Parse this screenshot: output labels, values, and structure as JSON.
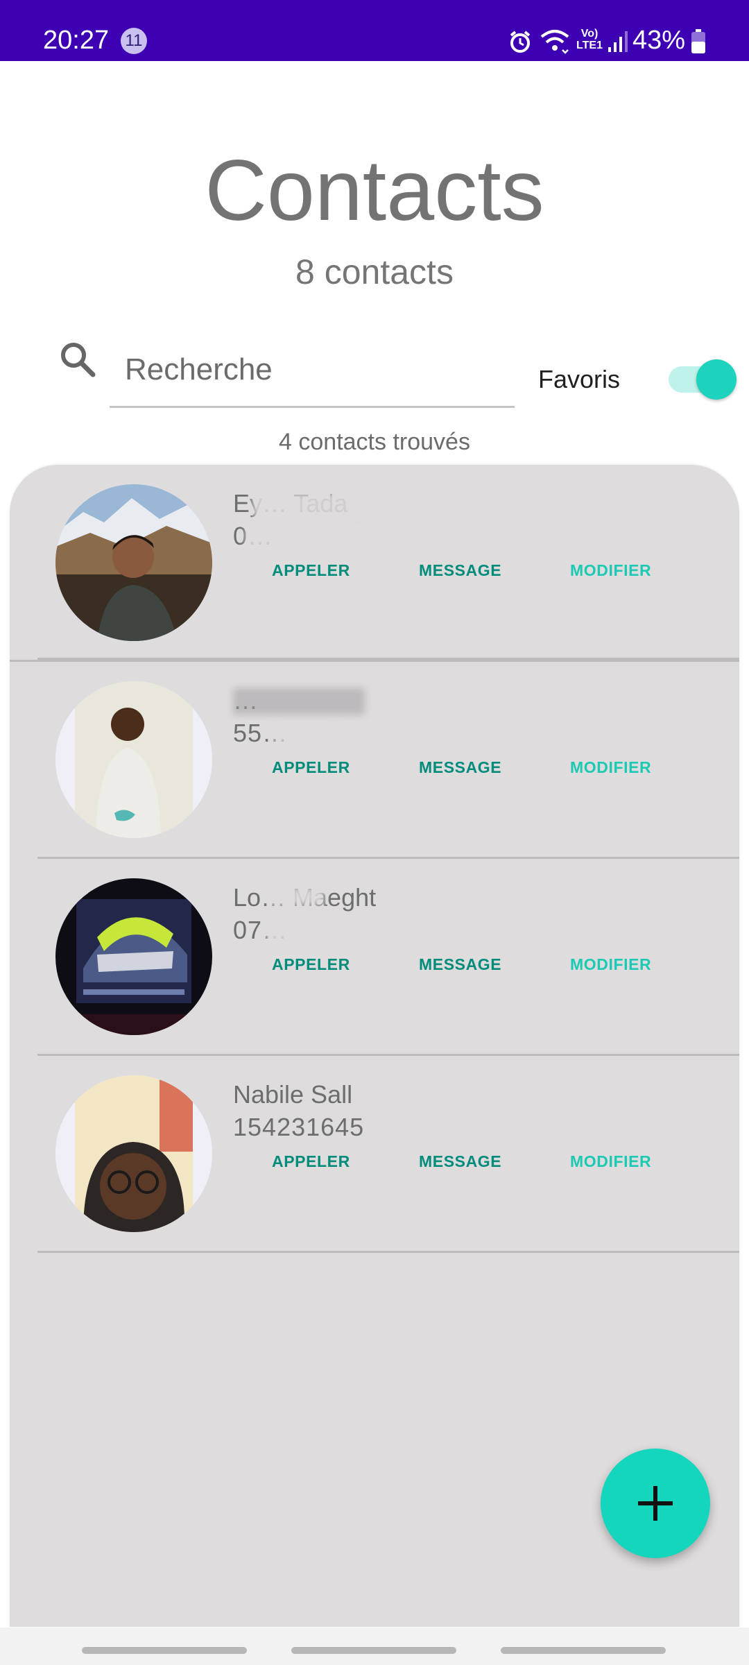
{
  "status_bar": {
    "time": "20:27",
    "notification_count": "11",
    "network_label": "Vo) LTE1",
    "battery": "43%",
    "icons": [
      "alarm-icon",
      "wifi-icon",
      "volte-icon",
      "signal-icon",
      "battery-icon"
    ]
  },
  "header": {
    "title": "Contacts",
    "count": "8 contacts"
  },
  "search": {
    "placeholder": "Recherche",
    "value": ""
  },
  "favorites": {
    "label": "Favoris",
    "enabled": true
  },
  "results": {
    "found_text": "4 contacts trouvés"
  },
  "contacts": [
    {
      "name": "Ey… Tada",
      "phone": "0…",
      "call_label": "APPELER",
      "message_label": "MESSAGE",
      "edit_label": "MODIFIER",
      "redacted": true
    },
    {
      "name": "…",
      "phone": "55…",
      "call_label": "APPELER",
      "message_label": "MESSAGE",
      "edit_label": "MODIFIER",
      "redacted": true
    },
    {
      "name": "Lo… Maeght",
      "phone": "07…",
      "call_label": "APPELER",
      "message_label": "MESSAGE",
      "edit_label": "MODIFIER",
      "redacted": true
    },
    {
      "name": "Nabile Sall",
      "phone": "154231645",
      "call_label": "APPELER",
      "message_label": "MESSAGE",
      "edit_label": "MODIFIER",
      "redacted": false
    }
  ],
  "fab": {
    "icon": "plus-icon"
  },
  "colors": {
    "status_bar": "#3d00b3",
    "accent": "#13d6bd",
    "button_text": "#008c7a",
    "edit_text": "#1ccab4",
    "panel": "#dedcdd"
  }
}
